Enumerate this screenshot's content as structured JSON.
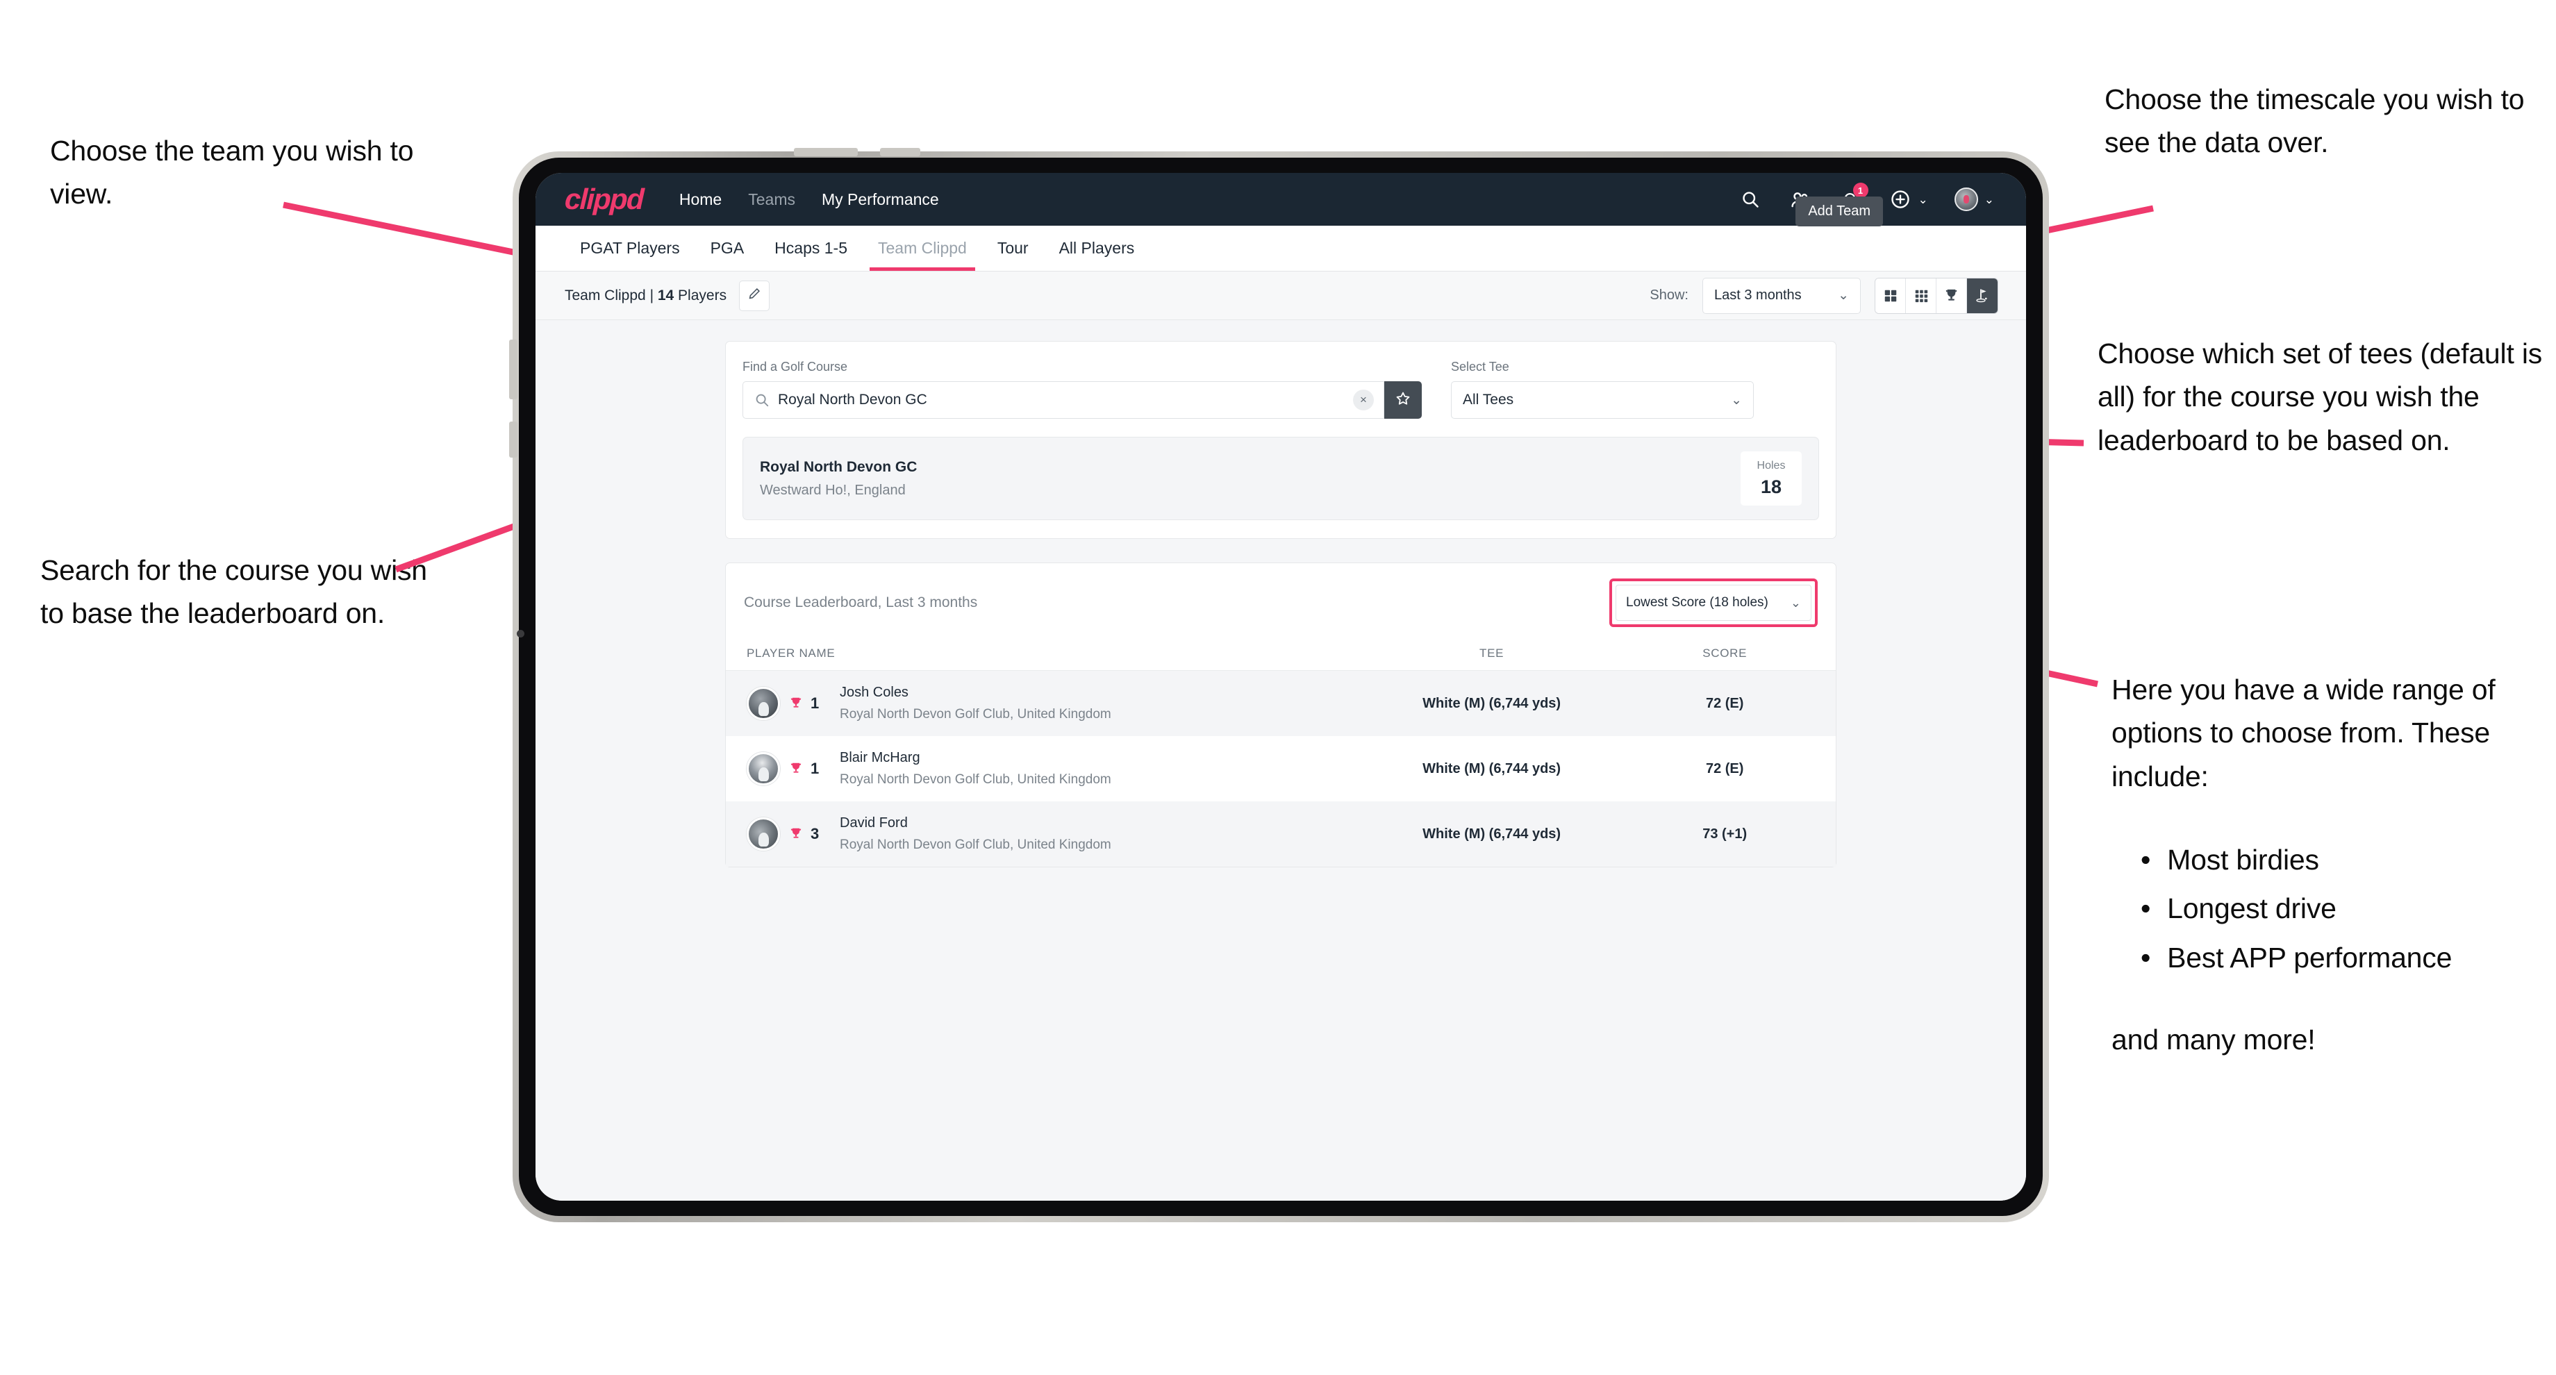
{
  "annotations": {
    "choose_team": "Choose the team you wish to view.",
    "search_course": "Search for the course you wish to base the leaderboard on.",
    "choose_timescale": "Choose the timescale you wish to see the data over.",
    "choose_tees": "Choose which set of tees (default is all) for the course you wish the leaderboard to be based on.",
    "options_intro": "Here you have a wide range of options to choose from. These include:",
    "options_list": [
      "Most birdies",
      "Longest drive",
      "Best APP performance"
    ],
    "options_tail": "and many more!",
    "bullet": "•"
  },
  "navbar": {
    "brand": "clippd",
    "links": [
      {
        "label": "Home",
        "active": true
      },
      {
        "label": "Teams",
        "active": false
      },
      {
        "label": "My Performance",
        "active": true
      }
    ],
    "icons": [
      "search-icon",
      "people-icon",
      "bell-icon",
      "plus-circle-icon",
      "avatar"
    ],
    "notification_count": "1",
    "chevron": "⌄"
  },
  "tabs": [
    {
      "label": "PGAT Players",
      "active": false,
      "dim": false
    },
    {
      "label": "PGA",
      "active": false,
      "dim": false
    },
    {
      "label": "Hcaps 1-5",
      "active": false,
      "dim": false
    },
    {
      "label": "Team Clippd",
      "active": true,
      "dim": true
    },
    {
      "label": "Tour",
      "active": false,
      "dim": false
    },
    {
      "label": "All Players",
      "active": false,
      "dim": false
    }
  ],
  "toolbar": {
    "team_name": "Team Clippd",
    "team_sep": " | ",
    "team_count": "14",
    "team_count_suffix": " Players",
    "edit_icon": "pencil-icon",
    "show_label": "Show:",
    "show_value": "Last 3 months",
    "chevron": "⌄",
    "views": [
      {
        "name": "grid-2x2-view",
        "selected": false
      },
      {
        "name": "grid-3x3-view",
        "selected": false
      },
      {
        "name": "trophy-view",
        "selected": false
      },
      {
        "name": "golf-flag-view",
        "selected": true
      }
    ],
    "tooltip": "Add Team"
  },
  "search": {
    "course_label": "Find a Golf Course",
    "course_value": "Royal North Devon GC",
    "course_placeholder": "Find a Golf Course",
    "clear_icon": "×",
    "star_icon": "star-icon",
    "tee_label": "Select Tee",
    "tee_value": "All Tees",
    "chevron": "⌄"
  },
  "course_result": {
    "name": "Royal North Devon GC",
    "location": "Westward Ho!, England",
    "holes_label": "Holes",
    "holes_value": "18"
  },
  "leaderboard": {
    "title": "Course Leaderboard,",
    "subtitle": " Last 3 months",
    "sort_value": "Lowest Score (18 holes)",
    "chevron": "⌄",
    "columns": [
      "PLAYER NAME",
      "TEE",
      "SCORE"
    ],
    "rows": [
      {
        "rank": "1",
        "player": "Josh Coles",
        "club": "Royal North Devon Golf Club, United Kingdom",
        "tee": "White (M) (6,744 yds)",
        "score": "72 (E)"
      },
      {
        "rank": "1",
        "player": "Blair McHarg",
        "club": "Royal North Devon Golf Club, United Kingdom",
        "tee": "White (M) (6,744 yds)",
        "score": "72 (E)"
      },
      {
        "rank": "3",
        "player": "David Ford",
        "club": "Royal North Devon Golf Club, United Kingdom",
        "tee": "White (M) (6,744 yds)",
        "score": "73 (+1)"
      }
    ]
  },
  "colors": {
    "accent": "#ef3a6d",
    "navbar": "#1b2733",
    "page_bg": "#f5f6f8",
    "dark_control": "#444c54"
  }
}
